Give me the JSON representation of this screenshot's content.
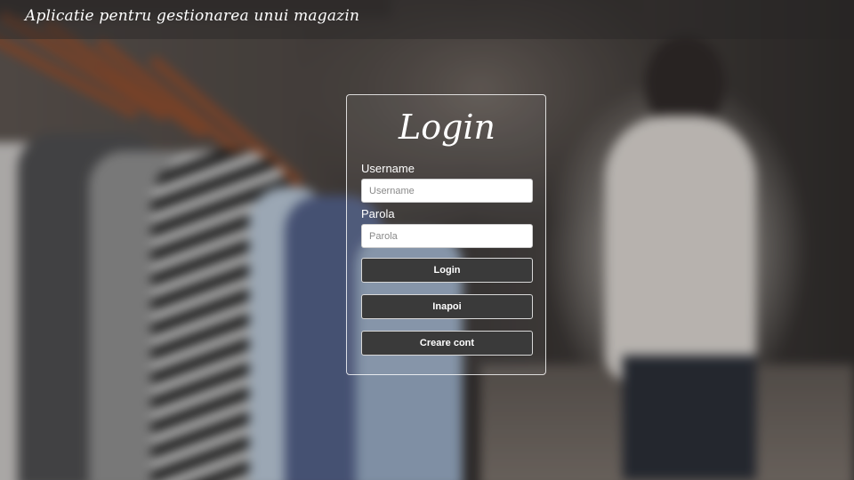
{
  "header": {
    "app_title": "Aplicatie pentru gestionarea unui magazin"
  },
  "login": {
    "title": "Login",
    "username_label": "Username",
    "username_placeholder": "Username",
    "username_value": "",
    "password_label": "Parola",
    "password_placeholder": "Parola",
    "password_value": "",
    "buttons": {
      "login": "Login",
      "back": "Inapoi",
      "create_account": "Creare cont"
    }
  },
  "colors": {
    "button_bg": "#3a3a3a",
    "panel_border": "#ffffff",
    "text": "#ffffff"
  }
}
